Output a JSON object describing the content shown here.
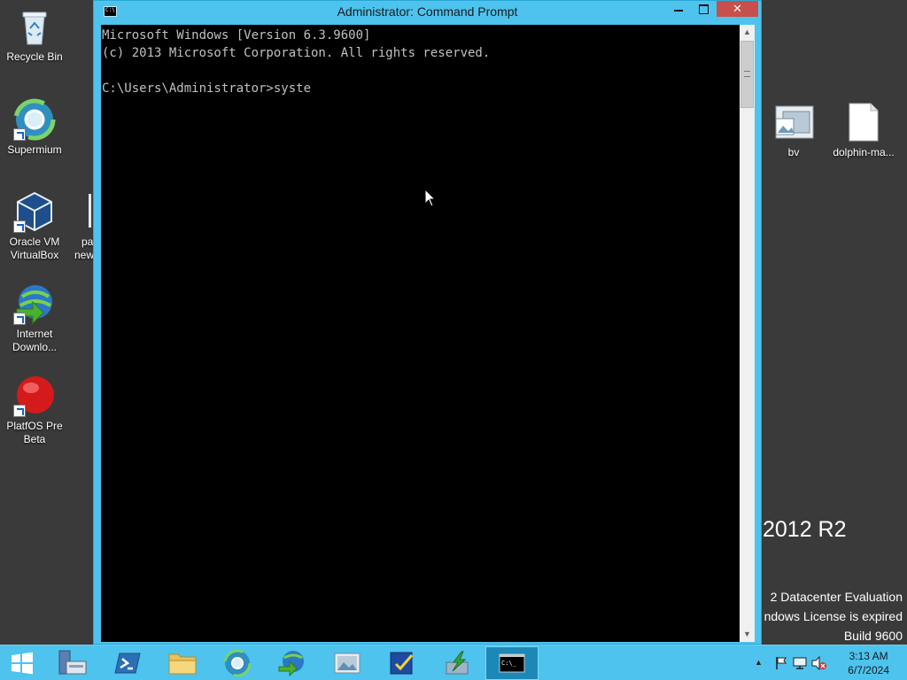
{
  "desktop": {
    "icons_left": [
      {
        "label": "Recycle Bin",
        "icon": "recycle-bin-icon"
      },
      {
        "label": "Supermium",
        "icon": "supermium-icon"
      },
      {
        "label": "Oracle VM VirtualBox",
        "icon": "virtualbox-icon"
      },
      {
        "label": "Internet Downlo...",
        "icon": "internet-download-manager-icon"
      },
      {
        "label": "PlatfOS Pre Beta",
        "icon": "platfos-icon"
      }
    ],
    "partial_icon": {
      "line1": "pa",
      "line2": "new"
    },
    "icons_right": [
      {
        "label": "bv",
        "icon": "image-folder-icon"
      },
      {
        "label": "dolphin-ma...",
        "icon": "blank-file-icon"
      }
    ],
    "watermark": {
      "version": "2012 R2",
      "line1": "2 Datacenter Evaluation",
      "line2": "ndows License is expired",
      "line3": "Build 9600"
    }
  },
  "window": {
    "title": "Administrator: Command Prompt",
    "minimize_label": "",
    "maximize_label": "",
    "close_label": "✕",
    "console_lines": [
      "Microsoft Windows [Version 6.3.9600]",
      "(c) 2013 Microsoft Corporation. All rights reserved.",
      "",
      "C:\\Users\\Administrator>syste"
    ]
  },
  "taskbar": {
    "buttons": [
      {
        "name": "start",
        "icon": "windows-logo-icon"
      },
      {
        "name": "server-manager",
        "icon": "server-manager-icon"
      },
      {
        "name": "powershell",
        "icon": "powershell-icon"
      },
      {
        "name": "file-explorer",
        "icon": "folder-icon"
      },
      {
        "name": "supermium",
        "icon": "supermium-icon"
      },
      {
        "name": "internet-download-manager",
        "icon": "idm-icon"
      },
      {
        "name": "image-viewer",
        "icon": "image-viewer-icon"
      },
      {
        "name": "notepad-edit",
        "icon": "notepad-icon"
      },
      {
        "name": "download-tool",
        "icon": "download-icon"
      },
      {
        "name": "command-prompt",
        "icon": "cmd-icon",
        "active": true
      }
    ],
    "tray": {
      "show_hidden_label": "▲",
      "clock_time": "3:13 AM",
      "clock_date": "6/7/2024"
    }
  },
  "colors": {
    "accent": "#4dc3ee",
    "desktop_bg": "#3a3a3a",
    "console_bg": "#000000",
    "console_text": "#c0c0c0",
    "close_button": "#c7504b"
  }
}
